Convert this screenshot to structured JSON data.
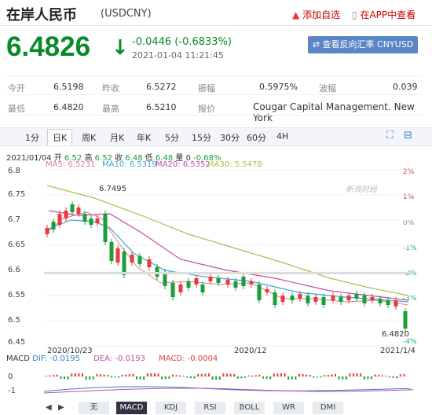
{
  "header": {
    "name": "在岸人民币",
    "code": "(USDCNY)",
    "link1": "添加自选",
    "link2": "在APP中查看"
  },
  "price": {
    "value": "6.4826",
    "change": "-0.0446 (-0.6833%)",
    "time": "2021-01-04 11:21:45",
    "reverse_btn": "查看反向汇率 CNYUSD"
  },
  "quotes": [
    {
      "k1": "今开",
      "v1": "6.5198",
      "k2": "昨收",
      "v2": "6.5272",
      "k3": "振幅",
      "v3": "0.5975%",
      "k4": "波幅",
      "v4": "0.039"
    },
    {
      "k1": "最低",
      "v1": "6.4820",
      "k2": "最高",
      "v2": "6.5210",
      "k3": "报价",
      "v3": "Cougar Capital Management. New York",
      "k4": "",
      "v4": ""
    }
  ],
  "tabs": [
    "1分",
    "日K",
    "周K",
    "月K",
    "年K",
    "5分",
    "15分",
    "30分",
    "60分",
    "4H"
  ],
  "info": {
    "date": "2021/01/04",
    "open_l": "开",
    "open": "6.52",
    "high_l": "高",
    "high": "6.52",
    "close_l": "收",
    "close": "6.48",
    "low_l": "低",
    "low": "6.48",
    "vol_l": "量",
    "vol": "0",
    "chg": "-0.68%"
  },
  "ma": {
    "ma5": "MA5: 6.5231",
    "ma10": "MA10: 6.5319",
    "ma20": "MA20: 6.5352",
    "ma30": "MA30: 5.5478"
  },
  "watermark": "新浪财经",
  "chart_data": {
    "type": "candlestick",
    "yticks": [
      "6.8",
      "6.75",
      "6.7",
      "6.65",
      "6.6",
      "6.55",
      "6.5",
      "6.45"
    ],
    "pct_ticks": [
      "2%",
      "1%",
      "0%",
      "-1%",
      "-2%",
      "-3%",
      "-4%"
    ],
    "xticks": [
      "2020/10/23",
      "2020/12",
      "2021/1/4"
    ],
    "max_label": "6.7495",
    "last_label": "6.4820",
    "ylim": [
      6.45,
      6.8
    ]
  },
  "macd": {
    "title": "MACD",
    "dif": "DIF: -0.0195",
    "dea": "DEA: -0.0193",
    "macd": "MACD: -0.0004",
    "yticks": [
      "0",
      "-1"
    ]
  },
  "bottom_tabs": [
    "无",
    "MACD",
    "KDJ",
    "RSI",
    "BOLL",
    "WR",
    "DMI"
  ],
  "colors": {
    "up": "#e53d3d",
    "down": "#1a9e3a",
    "ma5": "#e77c8f",
    "ma10": "#3aa9d4",
    "ma20": "#c04ea0",
    "ma30": "#a3c34e"
  }
}
